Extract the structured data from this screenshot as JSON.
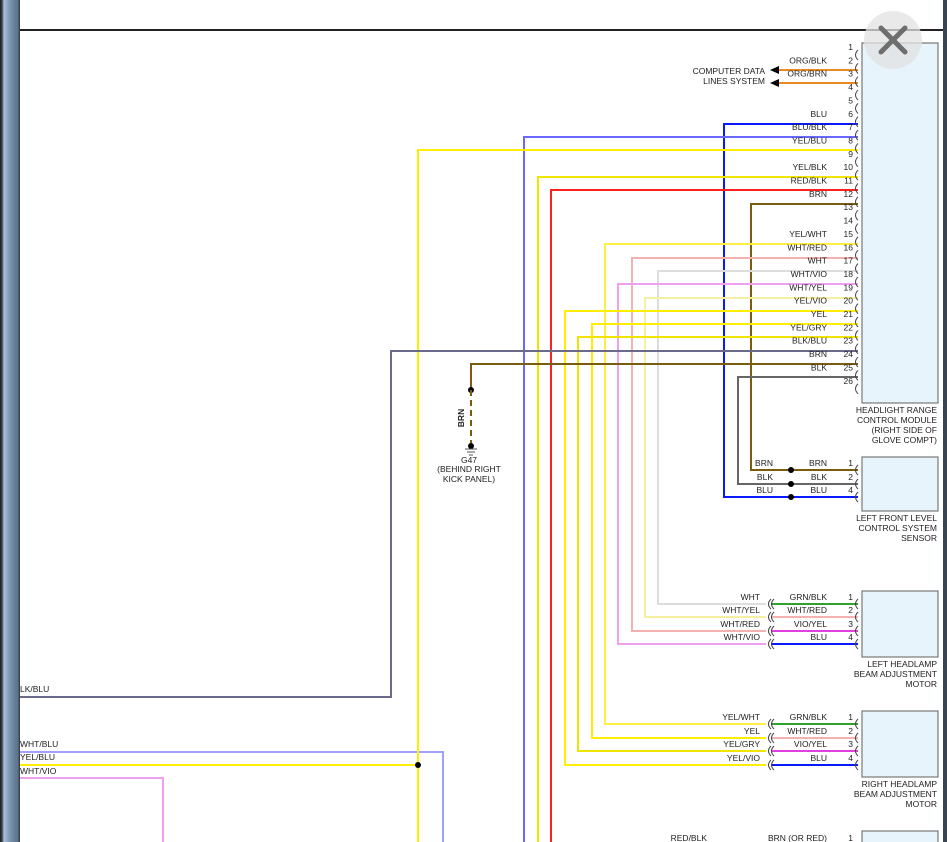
{
  "colors": {
    "BLU": "#0a1aff",
    "BLU/BLK": "#6868ff",
    "YEL/BLU": "#ffee00",
    "YEL/BLK": "#f2e600",
    "RED/BLK": "#ff2020",
    "BRN": "#7a5c10",
    "YEL/WHT": "#ffee44",
    "WHT/RED": "#f5b0b0",
    "WHT": "#dddddd",
    "WHT/VIO": "#f0a0f0",
    "WHT/YEL": "#f4f0a0",
    "YEL/VIO": "#ffee00",
    "YEL": "#ffee00",
    "YEL/GRY": "#f0e400",
    "BLK/BLU": "#6a6a8a",
    "BLK": "#666666",
    "ORG": "#e88a20",
    "GRN/BLK": "#30a030",
    "VIO/YEL": "#e040e0",
    "WHT/BLU": "#a0a0ff"
  },
  "close_icon": "close-icon",
  "computer_data": {
    "line1": "COMPUTER DATA",
    "line2": "LINES SYSTEM"
  },
  "module": {
    "label": [
      "HEADLIGHT RANGE",
      "CONTROL MODULE",
      "(RIGHT SIDE OF",
      "GLOVE COMPT)"
    ],
    "pins": [
      {
        "n": "1",
        "wire": ""
      },
      {
        "n": "2",
        "wire": "ORG/BLK"
      },
      {
        "n": "3",
        "wire": "ORG/BRN"
      },
      {
        "n": "4",
        "wire": ""
      },
      {
        "n": "5",
        "wire": ""
      },
      {
        "n": "6",
        "wire": "BLU"
      },
      {
        "n": "7",
        "wire": "BLU/BLK"
      },
      {
        "n": "8",
        "wire": "YEL/BLU"
      },
      {
        "n": "9",
        "wire": ""
      },
      {
        "n": "10",
        "wire": "YEL/BLK"
      },
      {
        "n": "11",
        "wire": "RED/BLK"
      },
      {
        "n": "12",
        "wire": "BRN"
      },
      {
        "n": "13",
        "wire": ""
      },
      {
        "n": "14",
        "wire": ""
      },
      {
        "n": "15",
        "wire": "YEL/WHT"
      },
      {
        "n": "16",
        "wire": "WHT/RED"
      },
      {
        "n": "17",
        "wire": "WHT"
      },
      {
        "n": "18",
        "wire": "WHT/VIO"
      },
      {
        "n": "19",
        "wire": "WHT/YEL"
      },
      {
        "n": "20",
        "wire": "YEL/VIO"
      },
      {
        "n": "21",
        "wire": "YEL"
      },
      {
        "n": "22",
        "wire": "YEL/GRY"
      },
      {
        "n": "23",
        "wire": "BLK/BLU"
      },
      {
        "n": "24",
        "wire": "BRN"
      },
      {
        "n": "25",
        "wire": "BLK"
      },
      {
        "n": "26",
        "wire": ""
      }
    ]
  },
  "ground": {
    "wire": "BRN",
    "id": "G47",
    "loc1": "(BEHIND RIGHT",
    "loc2": "KICK PANEL)"
  },
  "sensor": {
    "label": [
      "LEFT FRONT LEVEL",
      "CONTROL SYSTEM",
      "SENSOR"
    ],
    "pins": [
      {
        "n": "1",
        "left": "BRN",
        "right": "BRN"
      },
      {
        "n": "2",
        "left": "BLK",
        "right": "BLK"
      },
      {
        "n": "4",
        "left": "BLU",
        "right": "BLU"
      }
    ]
  },
  "left_motor": {
    "label": [
      "LEFT HEADLAMP",
      "BEAM ADJUSTMENT",
      "MOTOR"
    ],
    "pins": [
      {
        "n": "1",
        "left": "WHT",
        "right": "GRN/BLK"
      },
      {
        "n": "2",
        "left": "WHT/YEL",
        "right": "WHT/RED"
      },
      {
        "n": "3",
        "left": "WHT/RED",
        "right": "VIO/YEL"
      },
      {
        "n": "4",
        "left": "WHT/VIO",
        "right": "BLU"
      }
    ]
  },
  "right_motor": {
    "label": [
      "RIGHT HEADLAMP",
      "BEAM ADJUSTMENT",
      "MOTOR"
    ],
    "pins": [
      {
        "n": "1",
        "left": "YEL/WHT",
        "right": "GRN/BLK"
      },
      {
        "n": "2",
        "left": "YEL",
        "right": "WHT/RED"
      },
      {
        "n": "3",
        "left": "YEL/GRY",
        "right": "VIO/YEL"
      },
      {
        "n": "4",
        "left": "YEL/VIO",
        "right": "BLU"
      }
    ]
  },
  "left_edge_wires": [
    "LK/BLU",
    "WHT/BLU",
    "YEL/BLU",
    "WHT/VIO"
  ],
  "bottom": {
    "left": "RED/BLK",
    "right": "BRN (OR RED)",
    "pin": "1"
  }
}
